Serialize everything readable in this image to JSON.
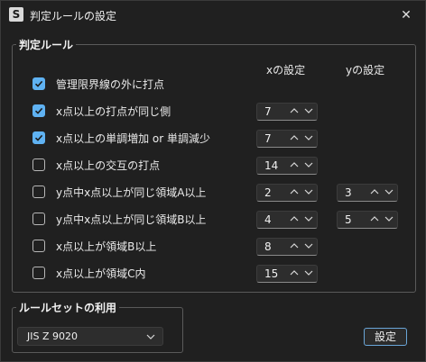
{
  "window": {
    "title": "判定ルールの設定",
    "app_icon_letter": "S",
    "close_symbol": "✕"
  },
  "rules_group": {
    "legend": "判定ルール",
    "x_header": "xの設定",
    "y_header": "yの設定",
    "rules": [
      {
        "label": "管理限界線の外に打点",
        "checked": true
      },
      {
        "label": "x点以上の打点が同じ側",
        "checked": true,
        "x": "7"
      },
      {
        "label": "x点以上の単調増加 or 単調減少",
        "checked": true,
        "x": "7"
      },
      {
        "label": "x点以上の交互の打点",
        "checked": false,
        "x": "14"
      },
      {
        "label": "y点中x点以上が同じ領域A以上",
        "checked": false,
        "x": "2",
        "y": "3"
      },
      {
        "label": "y点中x点以上が同じ領域B以上",
        "checked": false,
        "x": "4",
        "y": "5"
      },
      {
        "label": "x点以上が領域B以上",
        "checked": false,
        "x": "8"
      },
      {
        "label": "x点以上が領域C内",
        "checked": false,
        "x": "15"
      }
    ]
  },
  "ruleset_group": {
    "legend": "ルールセットの利用",
    "selected": "JIS Z 9020"
  },
  "apply_button": {
    "label": "設定"
  },
  "colors": {
    "accent": "#5fb2f2",
    "background": "#202020",
    "field": "#2d2d2d"
  }
}
